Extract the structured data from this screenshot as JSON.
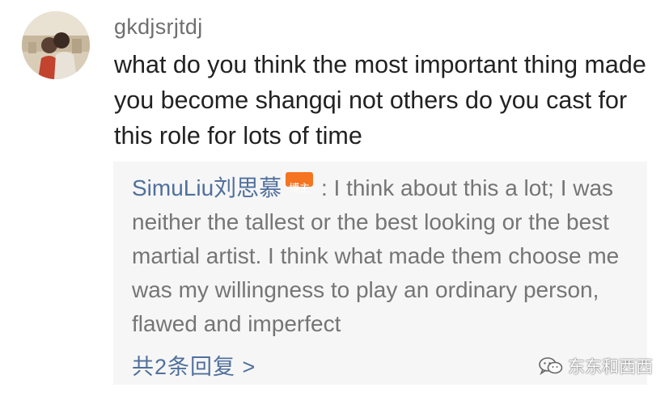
{
  "comment": {
    "username": "gkdjsrjtdj",
    "text": "what do you think the most important thing made you become shangqi not others do you cast for this role for lots of time"
  },
  "reply": {
    "author": "SimuLiu刘思慕",
    "badge": "博主",
    "text": " : I think about this a lot; I was neither the tallest or the best looking or the best martial artist. I think what made them choose me was my willingness to play an ordinary person, flawed and imperfect"
  },
  "reply_count_link": "共2条回复 >",
  "watermark": {
    "icon": "wechat-icon",
    "text": "东东和西西"
  },
  "colors": {
    "link": "#50709c",
    "badge": "#f47422",
    "reply_bg": "#f6f6f6"
  }
}
